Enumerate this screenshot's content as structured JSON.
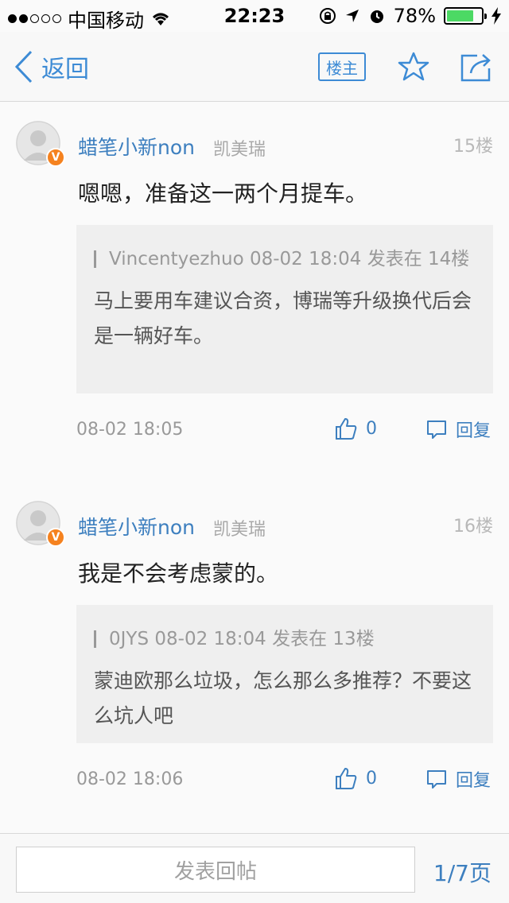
{
  "status_bar": {
    "carrier": "中国移动",
    "time": "22:23",
    "battery_percent": "78%",
    "battery_level": 0.78
  },
  "nav": {
    "back_label": "返回",
    "owner_label": "楼主"
  },
  "posts": [
    {
      "username": "蜡笔小新non",
      "car": "凯美瑞",
      "floor": "15楼",
      "body": "嗯嗯，准备这一两个月提车。",
      "quote_meta": "Vincentyezhuo 08-02 18:04 发表在 14楼",
      "quote_text": "马上要用车建议合资，博瑞等升级换代后会是一辆好车。",
      "time": "08-02 18:05",
      "likes": "0",
      "reply_label": "回复"
    },
    {
      "username": "蜡笔小新non",
      "car": "凯美瑞",
      "floor": "16楼",
      "body": "我是不会考虑蒙的。",
      "quote_meta": "0JYS 08-02 18:04 发表在 13楼",
      "quote_text": "蒙迪欧那么垃圾，怎么那么多推荐？不要这么坑人吧",
      "time": "08-02 18:06",
      "likes": "0",
      "reply_label": "回复"
    }
  ],
  "footer": {
    "reply_placeholder": "发表回帖",
    "page_indicator": "1/7页"
  },
  "colors": {
    "accent": "#3d7fbf",
    "badge": "#f5821f",
    "battery": "#4cd964"
  }
}
